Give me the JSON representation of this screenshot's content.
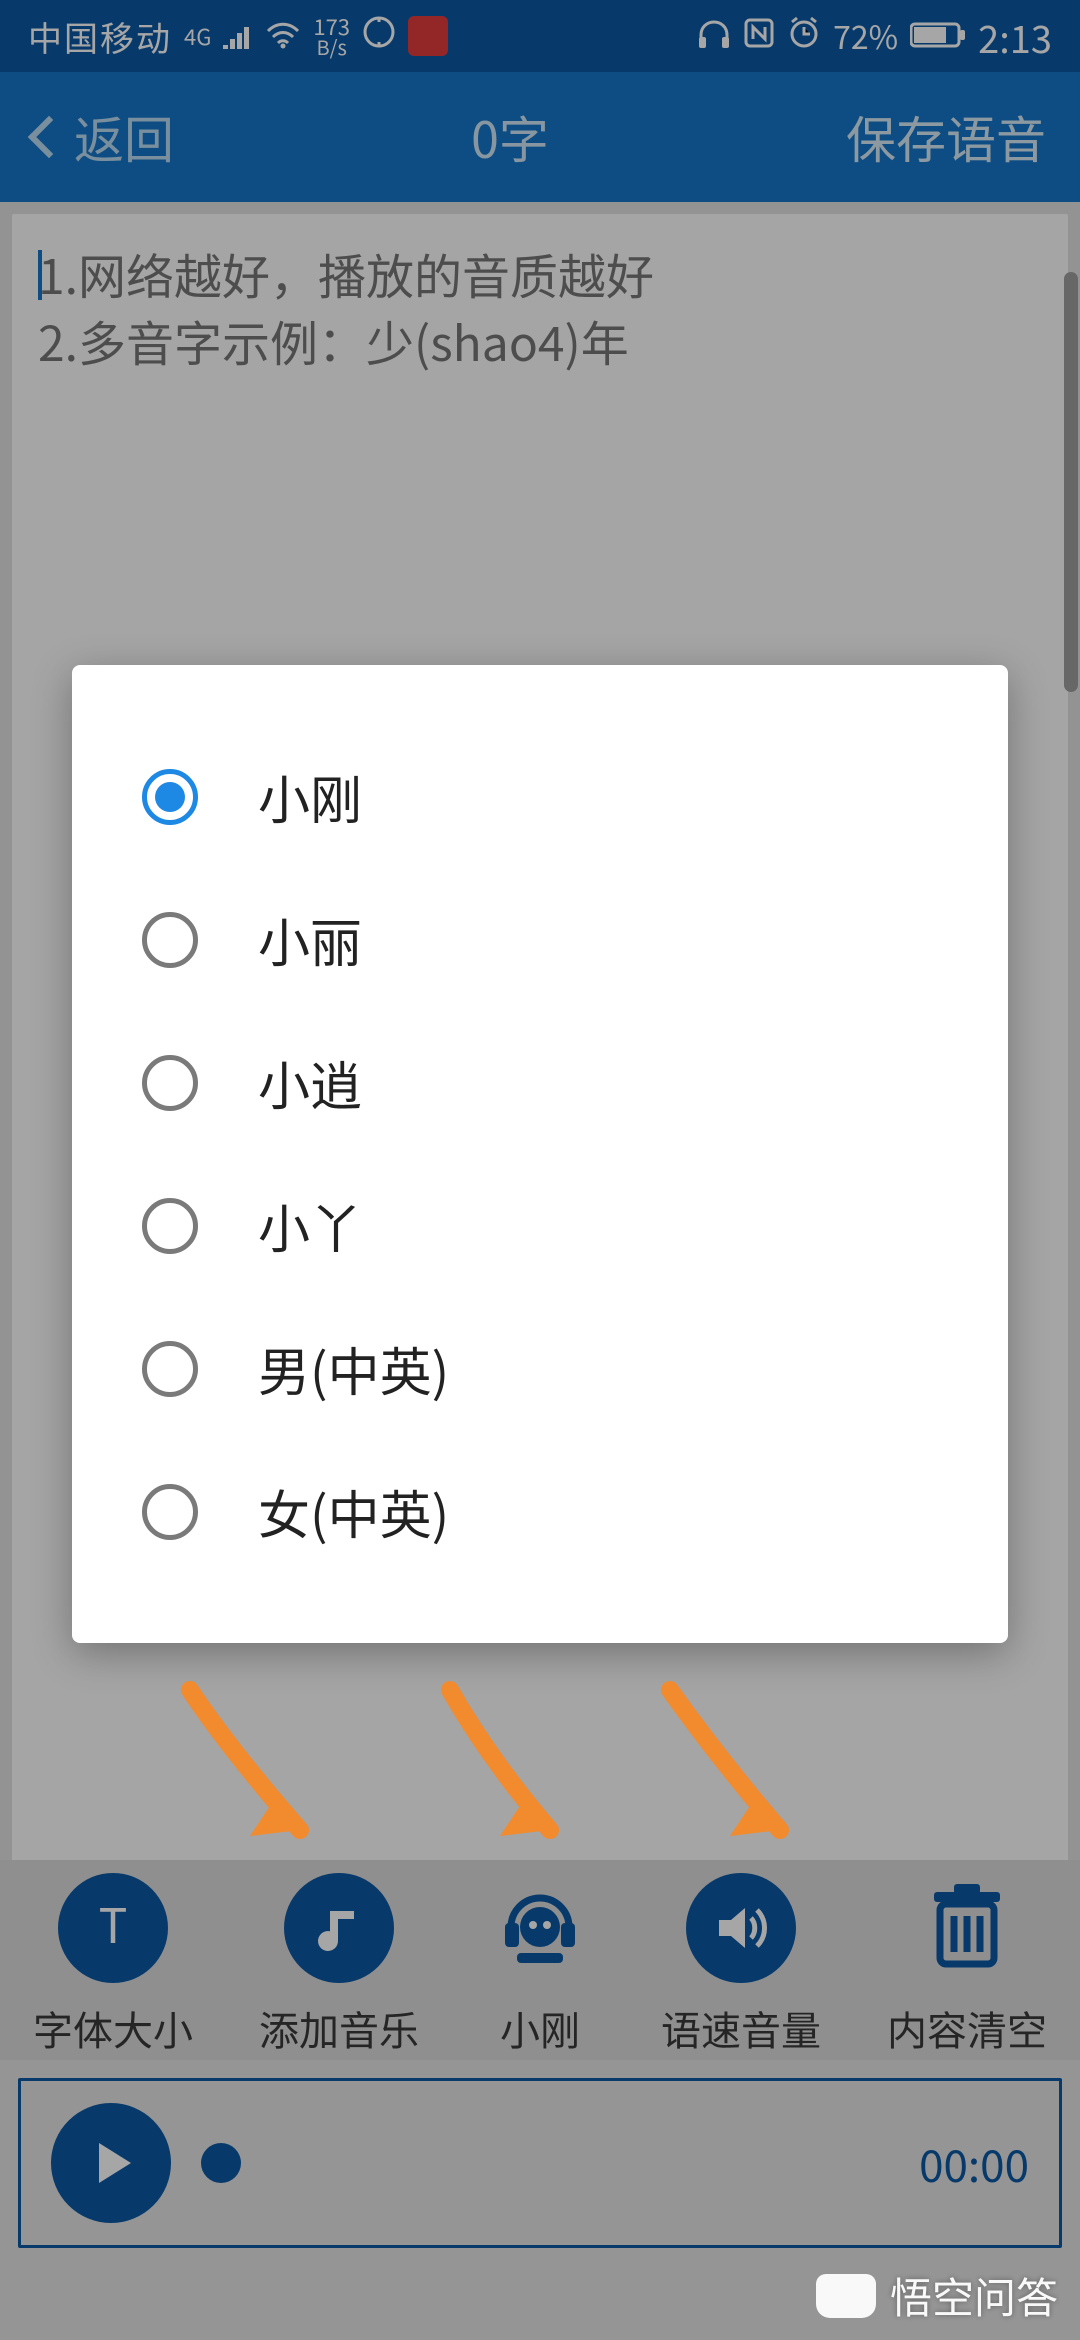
{
  "status": {
    "carrier": "中国移动",
    "net_badge": "4G",
    "data_rate_value": "173",
    "data_rate_unit": "B/s",
    "battery_text": "72%",
    "time": "2:13"
  },
  "header": {
    "back_label": "返回",
    "title": "0字",
    "save_label": "保存语音"
  },
  "editor": {
    "placeholder_line1": "1.网络越好，播放的音质越好",
    "placeholder_line2": "2.多音字示例：少(shao4)年"
  },
  "voice_dialog": {
    "options": [
      {
        "label": "小刚",
        "selected": true
      },
      {
        "label": "小丽",
        "selected": false
      },
      {
        "label": "小逍",
        "selected": false
      },
      {
        "label": "小丫",
        "selected": false
      },
      {
        "label": "男(中英)",
        "selected": false
      },
      {
        "label": "女(中英)",
        "selected": false
      }
    ]
  },
  "toolbar": {
    "items": [
      {
        "label": "字体大小",
        "icon": "text"
      },
      {
        "label": "添加音乐",
        "icon": "music"
      },
      {
        "label": "小刚",
        "icon": "voice"
      },
      {
        "label": "语速音量",
        "icon": "volume"
      },
      {
        "label": "内容清空",
        "icon": "trash"
      }
    ]
  },
  "player": {
    "time": "00:00"
  },
  "watermark": {
    "text": "悟空问答"
  },
  "colors": {
    "brand": "#0b5aa5",
    "accent": "#1e88e5",
    "arrow": "#f28a2e"
  }
}
